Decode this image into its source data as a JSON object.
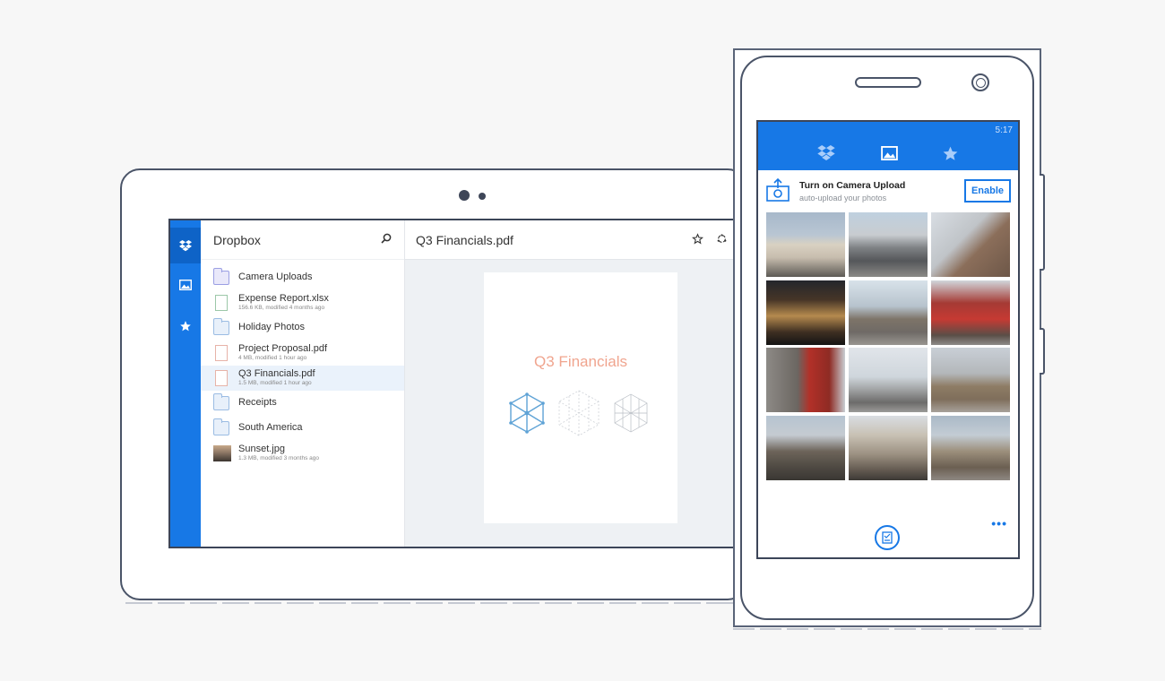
{
  "tablet": {
    "rail": {
      "icons": [
        "dropbox-icon",
        "photos-icon",
        "star-icon"
      ]
    },
    "files_pane": {
      "title": "Dropbox",
      "search_icon": "search-icon",
      "items": [
        {
          "name": "Camera Uploads",
          "meta": "",
          "type": "camera-folder"
        },
        {
          "name": "Expense Report.xlsx",
          "meta": "156.6 KB, modified 4 months ago",
          "type": "xlsx"
        },
        {
          "name": "Holiday Photos",
          "meta": "",
          "type": "folder"
        },
        {
          "name": "Project Proposal.pdf",
          "meta": "4 MB, modified 1 hour ago",
          "type": "pdf"
        },
        {
          "name": "Q3 Financials.pdf",
          "meta": "1.5 MB, modified 1 hour ago",
          "type": "pdf",
          "selected": true
        },
        {
          "name": "Receipts",
          "meta": "",
          "type": "folder"
        },
        {
          "name": "South America",
          "meta": "",
          "type": "shared-folder"
        },
        {
          "name": "Sunset.jpg",
          "meta": "1.3 MB, modified 3 months ago",
          "type": "image"
        }
      ]
    },
    "viewer": {
      "title": "Q3 Financials.pdf",
      "document_heading": "Q3 Financials",
      "actions": [
        "star-icon",
        "share-icon"
      ]
    }
  },
  "phone": {
    "status_time": "5:17",
    "tabs": [
      {
        "icon": "dropbox-icon",
        "active": false
      },
      {
        "icon": "photos-icon",
        "active": true
      },
      {
        "icon": "star-icon",
        "active": false
      }
    ],
    "camera_upload": {
      "title": "Turn on Camera Upload",
      "subtitle": "auto-upload your photos",
      "button_label": "Enable"
    },
    "photos_count_visible": 12,
    "bottom_bar": {
      "primary_icon": "tasks-icon",
      "more_label": "•••"
    }
  },
  "colors": {
    "accent": "#1778e6",
    "accent_dark": "#0e63c7",
    "doc_heading": "#f0a58f",
    "selected_row": "#eaf2fb"
  }
}
